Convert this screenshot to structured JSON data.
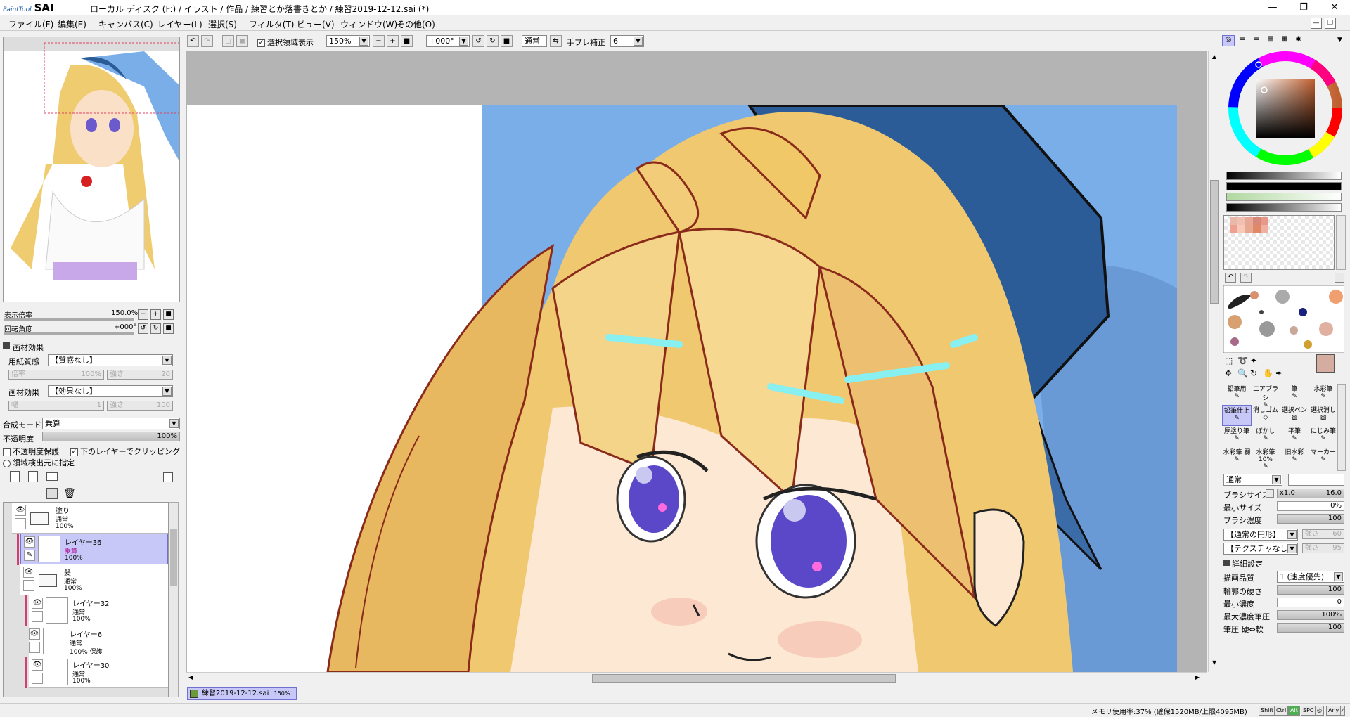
{
  "app": {
    "logo_small": "PaintTool",
    "logo_big": "SAI",
    "window_title": "ローカル ディスク (F:) / イラスト / 作品 / 練習とか落書きとか / 練習2019-12-12.sai (*)",
    "win_min": "—",
    "win_max": "❐",
    "win_close": "✕"
  },
  "menu": [
    "ファイル(F)",
    "編集(E)",
    "キャンバス(C)",
    "レイヤー(L)",
    "選択(S)",
    "フィルタ(T)",
    "ビュー(V)",
    "ウィンドウ(W)",
    "その他(O)"
  ],
  "navigator": {
    "zoom_label": "表示倍率",
    "zoom_value": "150.0%",
    "rotation_label": "回転角度",
    "rotation_value": "+000°"
  },
  "material": {
    "section_title": "画材効果",
    "paper_label": "用紙質感",
    "paper_value": "【質感なし】",
    "paper_scale_label": "倍率",
    "paper_scale_value": "100%",
    "paper_strength_label": "強さ",
    "paper_strength_value": "20",
    "effect_label": "画材効果",
    "effect_value": "【効果なし】",
    "effect_width_label": "幅",
    "effect_width_value": "1",
    "effect_strength_label": "強さ",
    "effect_strength_value": "100"
  },
  "layer_props": {
    "blend_label": "合成モード",
    "blend_value": "乗算",
    "opacity_label": "不透明度",
    "opacity_value": "100%",
    "protect_label": "不透明度保護",
    "clip_label": "下のレイヤーでクリッピング",
    "source_label": "領域検出元に指定"
  },
  "layers": [
    {
      "name": "塗り",
      "mode": "通常",
      "opacity": "100%",
      "type": "folder"
    },
    {
      "name": "レイヤー36",
      "mode": "乗算",
      "opacity": "100%",
      "type": "layer",
      "selected": true
    },
    {
      "name": "髪",
      "mode": "通常",
      "opacity": "100%",
      "type": "folder"
    },
    {
      "name": "レイヤー32",
      "mode": "通常",
      "opacity": "100%",
      "type": "layer"
    },
    {
      "name": "レイヤー6",
      "mode": "通常",
      "opacity": "100% 保護",
      "type": "layer"
    },
    {
      "name": "レイヤー30",
      "mode": "通常",
      "opacity": "100%",
      "type": "layer"
    }
  ],
  "toolbar": {
    "show_selection_label": "選択領域表示",
    "zoom_value": "150%",
    "rotation_value": "+000°",
    "mode_value": "通常",
    "stabilizer_label": "手ブレ補正",
    "stabilizer_value": "6"
  },
  "doc_tab": {
    "name": "練習2019-12-12.sai",
    "zoom": "150%"
  },
  "tools": [
    [
      "鉛筆用",
      "エアブラシ",
      "筆",
      "水彩筆"
    ],
    [
      "鉛筆仕上",
      "消しゴム",
      "選択ペン",
      "選択消し"
    ],
    [
      "厚塗り筆",
      "ぼかし",
      "平筆",
      "にじみ筆"
    ],
    [
      "水彩筆 弱",
      "水彩筆 10%",
      "旧水彩",
      "マーカー"
    ]
  ],
  "brush": {
    "blend_value": "通常",
    "size_label": "ブラシサイズ",
    "size_mult": "x1.0",
    "size_value": "16.0",
    "min_size_label": "最小サイズ",
    "min_size_value": "0%",
    "density_label": "ブラシ濃度",
    "density_value": "100",
    "shape_value": "【通常の円形】",
    "shape_strength_label": "強さ",
    "shape_strength_value": "60",
    "texture_value": "【テクスチャなし】",
    "texture_strength_label": "強さ",
    "texture_strength_value": "95",
    "detail_title": "詳細設定",
    "quality_label": "描画品質",
    "quality_value": "1 (速度優先)",
    "edge_label": "輪郭の硬さ",
    "edge_value": "100",
    "min_density_label": "最小濃度",
    "min_density_value": "0",
    "max_pressure_label": "最大濃度筆圧",
    "max_pressure_value": "100%",
    "pressure_label": "筆圧 硬⇔軟",
    "pressure_value": "100"
  },
  "status": {
    "memory": "メモリ使用率:37% (確保1520MB/上限4095MB)",
    "keys": [
      "Shift",
      "Ctrl",
      "Alt",
      "SPC",
      "◎",
      "Any",
      "⁄"
    ]
  },
  "colors": {
    "accent": "#c8c8f8",
    "selected_layer_border": "#d04070",
    "canvas_bg": "#b4b4b4",
    "hair": "#f0c870",
    "ribbon": "#2c5c98",
    "sky": "#7aaee8"
  },
  "swatches": [
    "#e8b8a8",
    "#f0c0b0",
    "#e8a898",
    "#d88878",
    "#e89888",
    "#f0a090",
    "#f8c8b8",
    "#e8a890",
    "#e08868",
    "#f0b0a0"
  ]
}
